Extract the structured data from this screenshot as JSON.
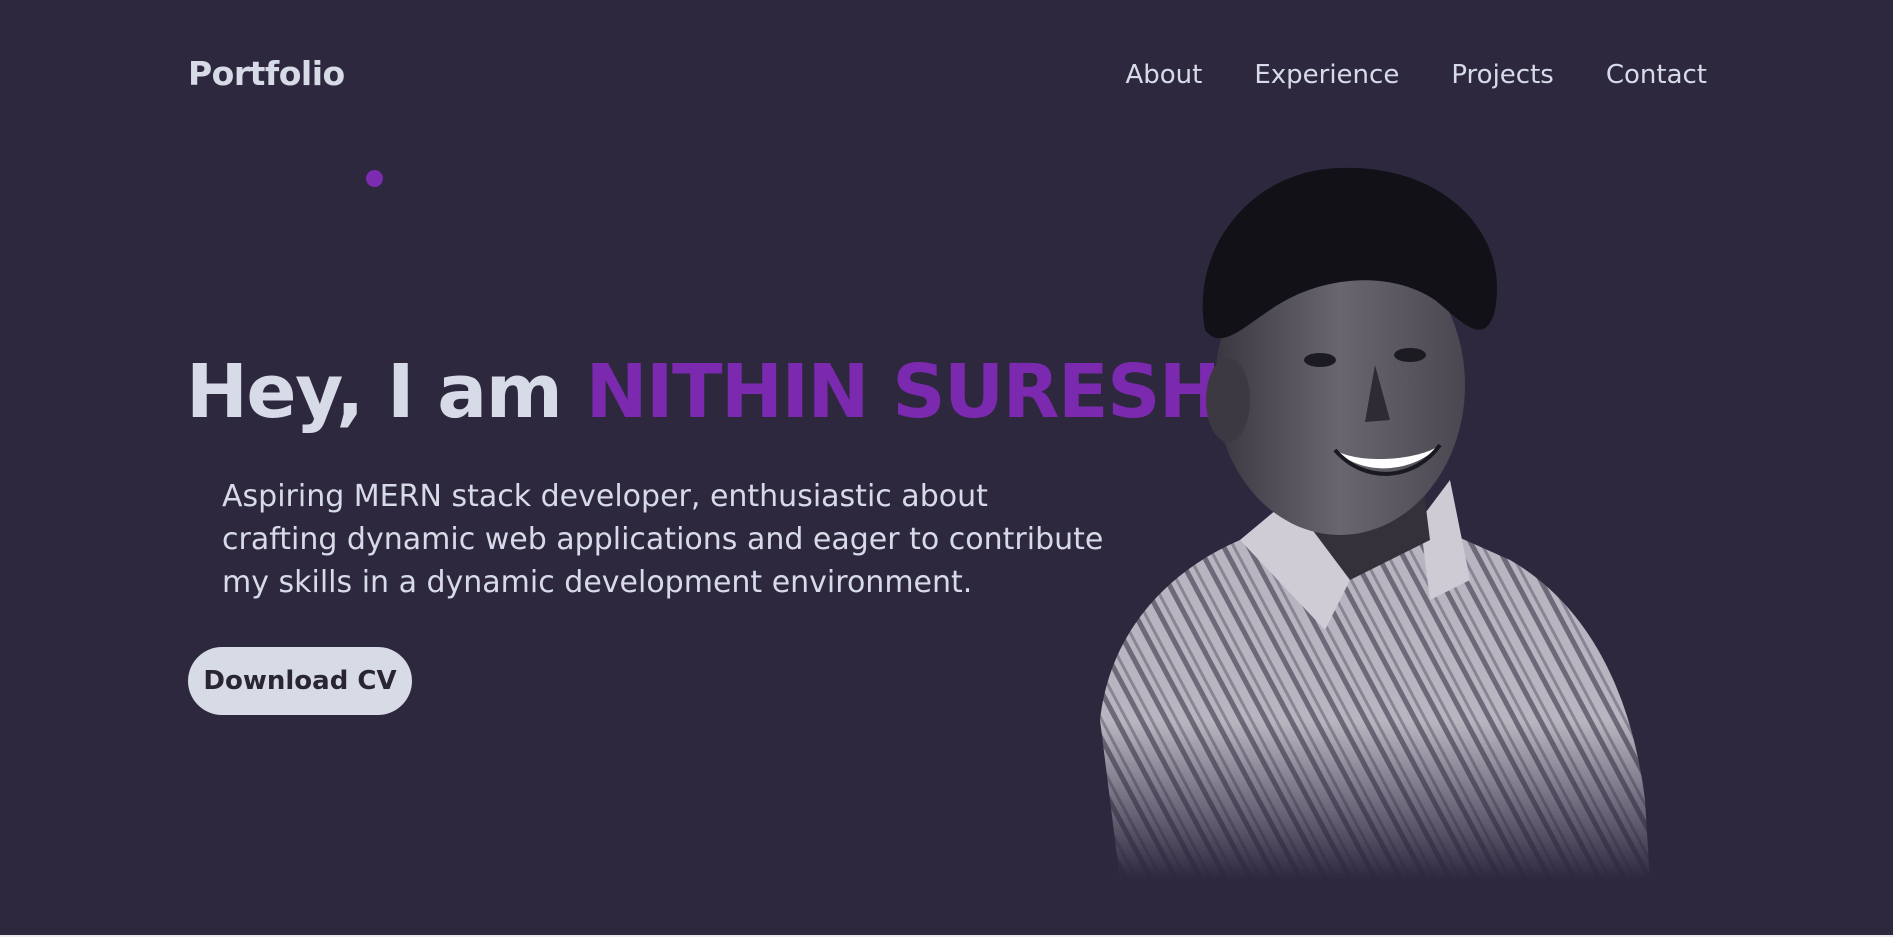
{
  "header": {
    "logo": "Portfolio",
    "nav": [
      "About",
      "Experience",
      "Projects",
      "Contact"
    ]
  },
  "hero": {
    "greeting": "Hey, I am ",
    "name": "NITHIN SURESH",
    "description": "Aspiring MERN stack developer, enthusiastic about\ncrafting dynamic web applications and eager to contribute\nmy skills in a dynamic development environment.",
    "button_label": "Download CV"
  },
  "colors": {
    "background": "#2e283f",
    "accent": "#7b2ab0",
    "text": "#d7dbe8",
    "button_bg": "#d7dbe6"
  },
  "portrait": {
    "description_icon": "person-photo"
  }
}
